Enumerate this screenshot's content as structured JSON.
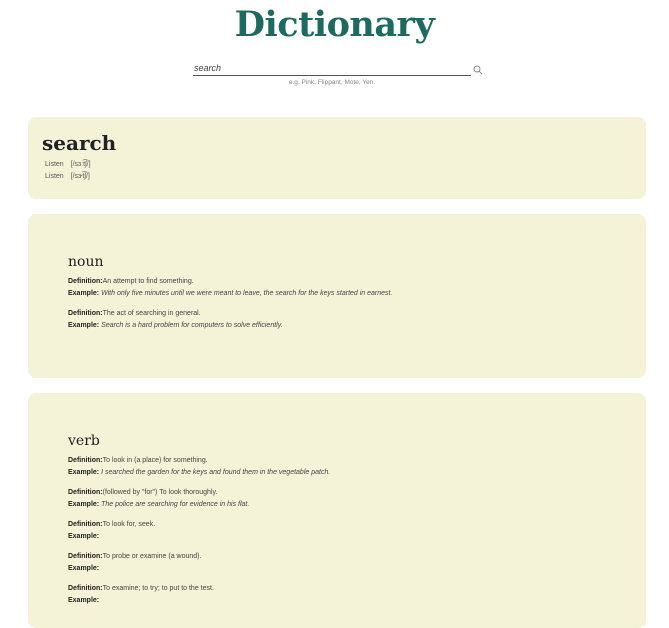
{
  "header": {
    "title": "Dictionary"
  },
  "search": {
    "value": "search",
    "hint": "e.g. Pink, Flippant, Mote, Yen."
  },
  "entry": {
    "word": "search",
    "phonetics": [
      {
        "listen": "Listen",
        "text": "[/sɜːt͡ʃ/]"
      },
      {
        "listen": "Listen",
        "text": "[/sɝt͡ʃ/]"
      }
    ],
    "labels": {
      "definition": "Definition:",
      "example": "Example:"
    },
    "meanings": [
      {
        "pos": "noun",
        "definitions": [
          {
            "definition": "An attempt to find something.",
            "example": "With only five minutes until we were meant to leave, the search for the keys started in earnest."
          },
          {
            "definition": "The act of searching in general.",
            "example": "Search is a hard problem for computers to solve efficiently."
          }
        ]
      },
      {
        "pos": "verb",
        "definitions": [
          {
            "definition": "To look in (a place) for something.",
            "example": "I searched the garden for the keys and found them in the vegetable patch."
          },
          {
            "definition": "(followed by \"for\") To look thoroughly.",
            "example": "The police are searching for evidence in his flat."
          },
          {
            "definition": "To look for, seek.",
            "example": ""
          },
          {
            "definition": "To probe or examine (a wound).",
            "example": ""
          },
          {
            "definition": "To examine; to try; to put to the test.",
            "example": ""
          }
        ]
      }
    ]
  }
}
